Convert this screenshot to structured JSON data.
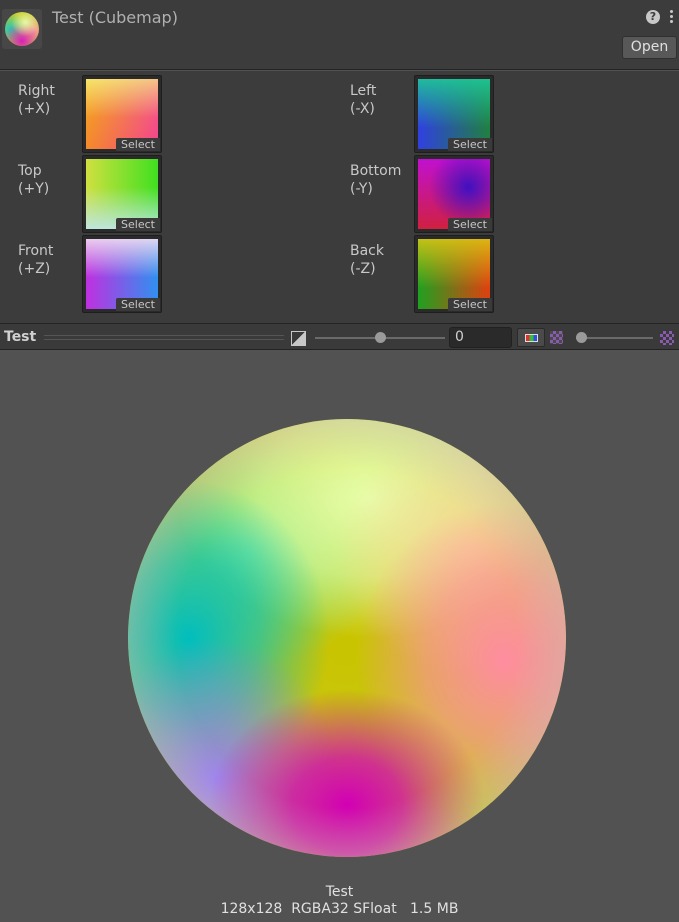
{
  "header": {
    "title": "Test (Cubemap)",
    "help_icon": "?",
    "icons": [
      "cubemap-asset-icon",
      "help-icon",
      "kebab-menu-icon"
    ],
    "open_label": "Open"
  },
  "faces": [
    {
      "label": "Right\n(+X)",
      "select": "Select"
    },
    {
      "label": "Left\n(-X)",
      "select": "Select"
    },
    {
      "label": "Top\n(+Y)",
      "select": "Select"
    },
    {
      "label": "Bottom\n(-Y)",
      "select": "Select"
    },
    {
      "label": "Front\n(+Z)",
      "select": "Select"
    },
    {
      "label": "Back\n(-Z)",
      "select": "Select"
    }
  ],
  "preview": {
    "title": "Test",
    "mip_value": "0",
    "exposure_slider_fraction": 0.5,
    "mip_slider_fraction": 0.0,
    "icons": [
      "exposure-icon",
      "rgb-channel-icon",
      "alpha-icon",
      "checker-icon"
    ],
    "info_name": "Test",
    "info_details": "128x128  RGBA32 SFloat   1.5 MB"
  },
  "colors": {
    "panel_bg": "#3c3c3c",
    "preview_bg": "#525252",
    "field_bg": "#2a2a2a"
  }
}
